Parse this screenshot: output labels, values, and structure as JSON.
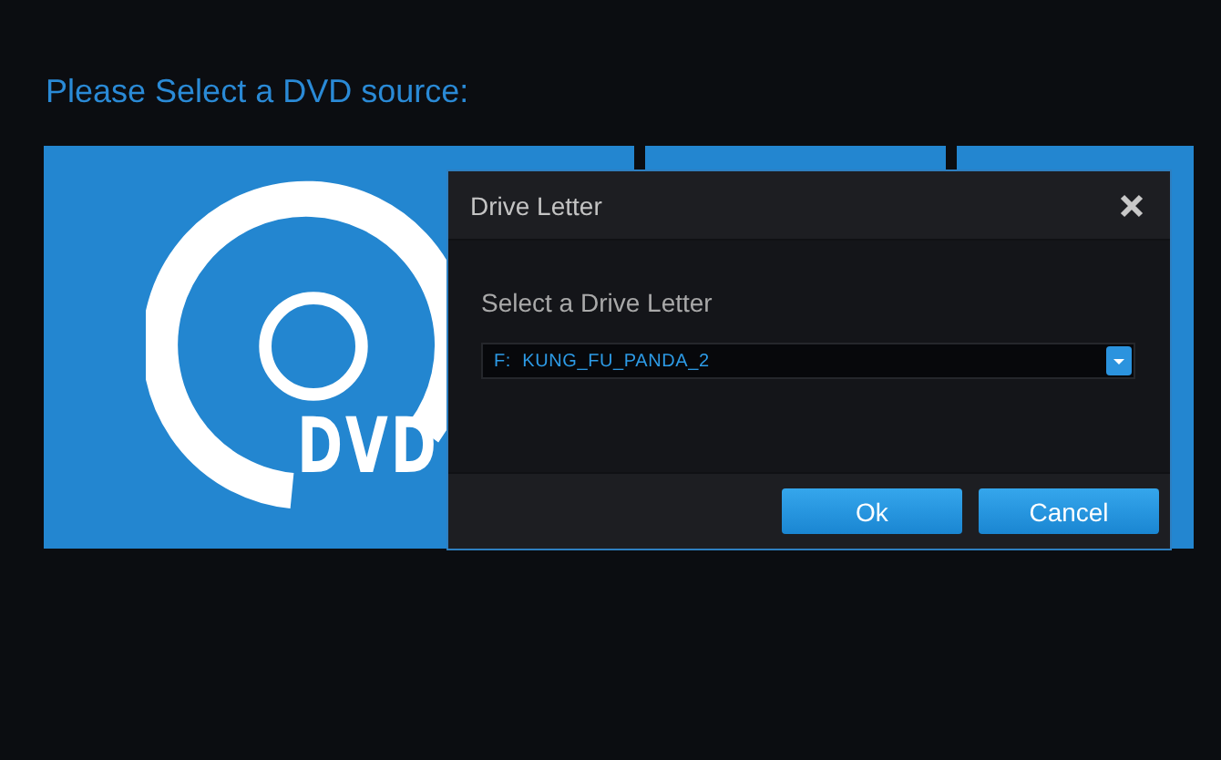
{
  "heading": "Please Select a DVD source:",
  "sources": [
    {
      "kind": "dvd",
      "label": "DVD"
    },
    {
      "kind": "blank"
    },
    {
      "kind": "blank"
    }
  ],
  "dialog": {
    "title": "Drive Letter",
    "prompt": "Select a Drive Letter",
    "drive": "F:  KUNG_FU_PANDA_2",
    "buttons": [
      "Ok",
      "Cancel"
    ]
  }
}
